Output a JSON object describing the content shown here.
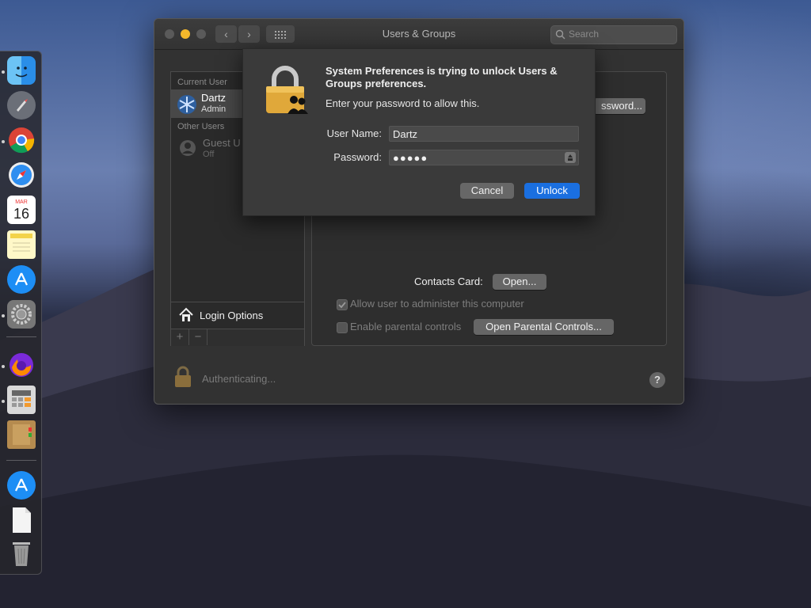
{
  "window": {
    "title": "Users & Groups",
    "search_placeholder": "Search"
  },
  "sidebar": {
    "current_user_header": "Current User",
    "current_user": {
      "name": "Dartz",
      "role": "Admin"
    },
    "other_users_header": "Other Users",
    "other_user": {
      "name": "Guest U",
      "status": "Off"
    },
    "login_options_label": "Login Options",
    "add_label": "+",
    "remove_label": "−"
  },
  "panel": {
    "password_button": "ssword...",
    "contacts_card_label": "Contacts Card:",
    "contacts_open_button": "Open...",
    "allow_admin_label": "Allow user to administer this computer",
    "parental_label": "Enable parental controls",
    "open_parental_button": "Open Parental Controls..."
  },
  "footer": {
    "status_text": "Authenticating...",
    "help_label": "?"
  },
  "dialog": {
    "title": "System Preferences is trying to unlock Users & Groups preferences.",
    "subtitle": "Enter your password to allow this.",
    "username_label": "User Name:",
    "username_value": "Dartz",
    "password_label": "Password:",
    "password_value": "●●●●●",
    "cancel_label": "Cancel",
    "unlock_label": "Unlock"
  },
  "dock": {
    "calendar_month": "MAR",
    "calendar_day": "16",
    "apps": [
      "finder-icon",
      "launchpad-icon",
      "chrome-icon",
      "safari-icon",
      "calendar-icon",
      "notes-icon",
      "app-store-icon",
      "system-preferences-icon",
      "firefox-icon",
      "calculator-icon",
      "notebook-icon",
      "app-store-icon",
      "document-icon",
      "trash-icon"
    ]
  },
  "colors": {
    "accent": "#1a6fe0",
    "window_bg": "#323232",
    "lock_gold": "#e0a83a"
  }
}
